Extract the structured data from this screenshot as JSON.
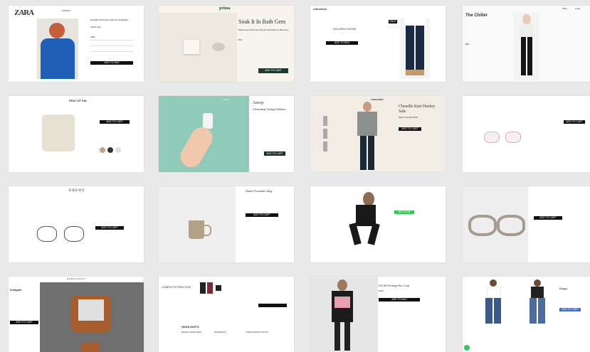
{
  "cards": {
    "zara": {
      "logo": "ZARA",
      "nav": "WOMAN",
      "product": "BLAZER WITH ROLLED-UP SLEEVES",
      "price": "49.90 USD",
      "size_label": "SIZE",
      "add_label": "ADD TO BAG"
    },
    "prima": {
      "logo": "prima",
      "title": "Soak It In Bath Gem",
      "subtitle": "Effervescent Mineral Soak for Relaxation & Recovery",
      "price": "$36",
      "buy_label": "ADD TO CART"
    },
    "rollingstone": {
      "logo": "rollnstone",
      "product": "GOLDEN GOOSE",
      "btn": "ADD TO BAG",
      "sale": "SALE"
    },
    "chiller": {
      "title": "The Chiller",
      "nav1": "Shop",
      "nav2": "Login",
      "price": "$98"
    },
    "jacket": {
      "logo": "FEAT OF SIN",
      "btn": "ADD TO CART"
    },
    "aesop": {
      "logo": "Aesop",
      "title": "Aesop",
      "subtitle": "Volumising Styling Addition",
      "btn": "ADD TO CART"
    },
    "turtleneck": {
      "logo": "LONGHORN",
      "title": "Chenille Knit Henley Sale",
      "subtitle": "NEW COLLECTION",
      "btn": "ADD TO CART"
    },
    "glasses1": {
      "btn": "ADD TO CART"
    },
    "krewe": {
      "logo": "KREWE",
      "btn": "ADD TO CART"
    },
    "mug": {
      "title": "Heath Porcelain Mug",
      "btn": "ADD TO CART"
    },
    "tights": {
      "btn": "BUY NOW"
    },
    "glasses2": {
      "btn": "ADD TO CART"
    },
    "backpack": {
      "logo": "HARDGRAFT",
      "title": "Instigate",
      "btn": "ADD TO CART"
    },
    "complete": {
      "logo": "COMPLETETHELOOK",
      "highlights": "HIGHLIGHTS",
      "col1": "DESIGN FEATURES",
      "col2": "MATERIALS",
      "col3": "CARE INSTRUCTIONS"
    },
    "coat": {
      "title": "SCLB Printing Rec Coat",
      "price": "$195",
      "btn": "ADD TO BAG"
    },
    "jeans": {
      "title": "Baggy",
      "btn": "ADD TO CART"
    }
  },
  "colors": {
    "accent_green": "#34c759",
    "teal": "#8fcbb8",
    "blazer_blue": "#1f5fb8",
    "beige": "#f2ece4"
  }
}
